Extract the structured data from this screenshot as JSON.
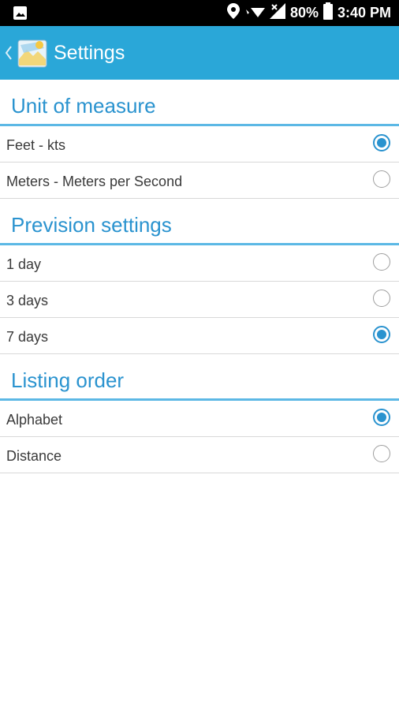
{
  "status_bar": {
    "battery": "80%",
    "time": "3:40 PM",
    "icons": [
      "image-icon",
      "location-icon",
      "wifi-icon",
      "signal-icon",
      "battery-icon"
    ]
  },
  "app_bar": {
    "title": "Settings",
    "icons": [
      "back-chevron-icon",
      "app-logo-icon"
    ]
  },
  "sections": [
    {
      "title": "Unit of measure",
      "options": [
        {
          "label": "Feet - kts",
          "selected": true
        },
        {
          "label": "Meters - Meters per Second",
          "selected": false
        }
      ]
    },
    {
      "title": "Prevision settings",
      "options": [
        {
          "label": "1 day",
          "selected": false
        },
        {
          "label": "3 days",
          "selected": false
        },
        {
          "label": "7 days",
          "selected": true
        }
      ]
    },
    {
      "title": "Listing order",
      "options": [
        {
          "label": "Alphabet",
          "selected": true
        },
        {
          "label": "Distance",
          "selected": false
        }
      ]
    }
  ],
  "colors": {
    "app_bar": "#2aa7d8",
    "accent": "#2a93cf",
    "status_bar": "#000000"
  }
}
